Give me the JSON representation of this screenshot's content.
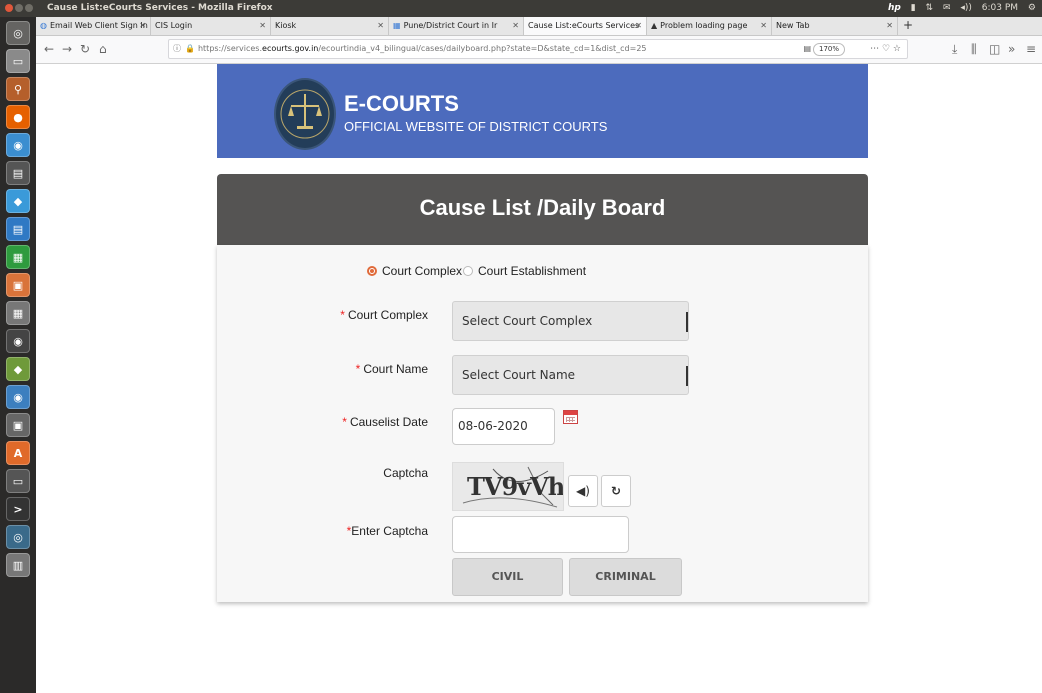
{
  "system": {
    "window_title": "Cause List:eCourts Services - Mozilla Firefox",
    "clock": "6:03 PM"
  },
  "tabs": [
    {
      "label": "Email Web Client Sign In"
    },
    {
      "label": "CIS Login"
    },
    {
      "label": "Kiosk"
    },
    {
      "label": "Pune/District Court in Ir"
    },
    {
      "label": "Cause List:eCourts Services"
    },
    {
      "label": "Problem loading page"
    },
    {
      "label": "New Tab"
    }
  ],
  "nav": {
    "url_prefix": "https://services.",
    "url_domain": "ecourts.gov.in",
    "url_path": "/ecourtindia_v4_bilingual/cases/dailyboard.php?state=D&state_cd=1&dist_cd=25",
    "zoom": "170%"
  },
  "banner": {
    "title": "E-COURTS",
    "subtitle": "OFFICIAL WEBSITE OF DISTRICT COURTS",
    "brand_color": "#4c6bbd"
  },
  "heading": "Cause List /Daily Board",
  "form": {
    "radio_court_complex": "Court Complex",
    "radio_court_establishment": "Court Establishment",
    "court_complex_label": "Court Complex",
    "court_complex_value": "Select Court Complex",
    "court_name_label": "Court Name",
    "court_name_value": "Select Court Name",
    "date_label": "Causelist Date",
    "date_value": "08-06-2020",
    "captcha_label": "Captcha",
    "captcha_text": "TV9vVh",
    "enter_captcha_label": "Enter Captcha",
    "enter_captcha_value": "",
    "required_mark": "*",
    "civil_button": "CIVIL",
    "criminal_button": "CRIMINAL"
  }
}
